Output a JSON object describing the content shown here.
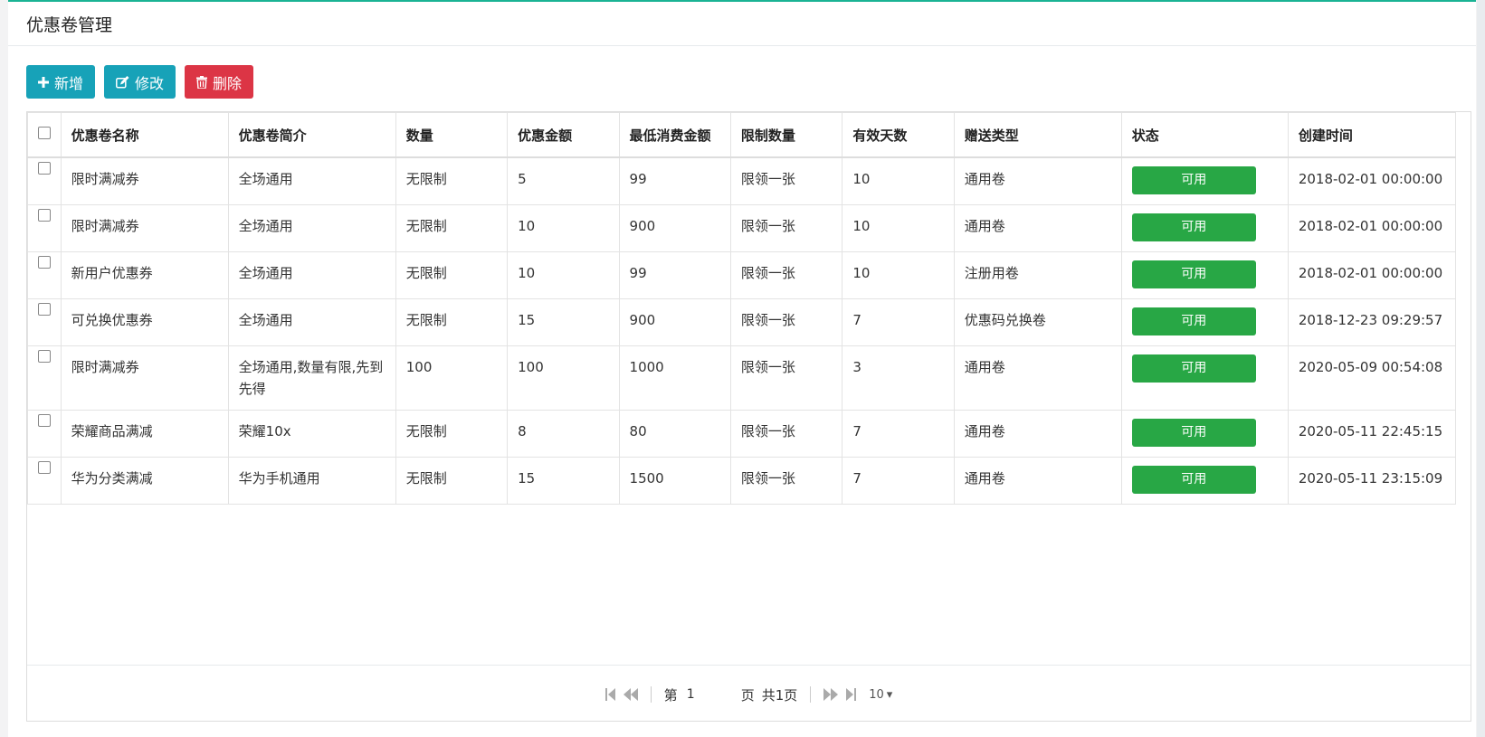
{
  "page": {
    "title": "优惠卷管理"
  },
  "toolbar": {
    "add_label": "新增",
    "edit_label": "修改",
    "delete_label": "删除"
  },
  "colors": {
    "accent": "#17a2b8",
    "danger": "#dc3545",
    "success": "#28a745"
  },
  "table": {
    "headers": [
      "优惠卷名称",
      "优惠卷简介",
      "数量",
      "优惠金额",
      "最低消费金额",
      "限制数量",
      "有效天数",
      "赠送类型",
      "状态",
      "创建时间"
    ],
    "rows": [
      [
        "限时满减券",
        "全场通用",
        "无限制",
        "5",
        "99",
        "限领一张",
        "10",
        "通用卷",
        "可用",
        "2018-02-01 00:00:00"
      ],
      [
        "限时满减券",
        "全场通用",
        "无限制",
        "10",
        "900",
        "限领一张",
        "10",
        "通用卷",
        "可用",
        "2018-02-01 00:00:00"
      ],
      [
        "新用户优惠券",
        "全场通用",
        "无限制",
        "10",
        "99",
        "限领一张",
        "10",
        "注册用卷",
        "可用",
        "2018-02-01 00:00:00"
      ],
      [
        "可兑换优惠券",
        "全场通用",
        "无限制",
        "15",
        "900",
        "限领一张",
        "7",
        "优惠码兑换卷",
        "可用",
        "2018-12-23 09:29:57"
      ],
      [
        "限时满减券",
        "全场通用,数量有限,先到先得",
        "100",
        "100",
        "1000",
        "限领一张",
        "3",
        "通用卷",
        "可用",
        "2020-05-09 00:54:08"
      ],
      [
        "荣耀商品满减",
        "荣耀10x",
        "无限制",
        "8",
        "80",
        "限领一张",
        "7",
        "通用卷",
        "可用",
        "2020-05-11 22:45:15"
      ],
      [
        "华为分类满减",
        "华为手机通用",
        "无限制",
        "15",
        "1500",
        "限领一张",
        "7",
        "通用卷",
        "可用",
        "2020-05-11 23:15:09"
      ]
    ]
  },
  "pager": {
    "page_prefix": "第",
    "current_page": "1",
    "page_suffix": "页",
    "total_label": "共1页",
    "page_size": "10"
  }
}
